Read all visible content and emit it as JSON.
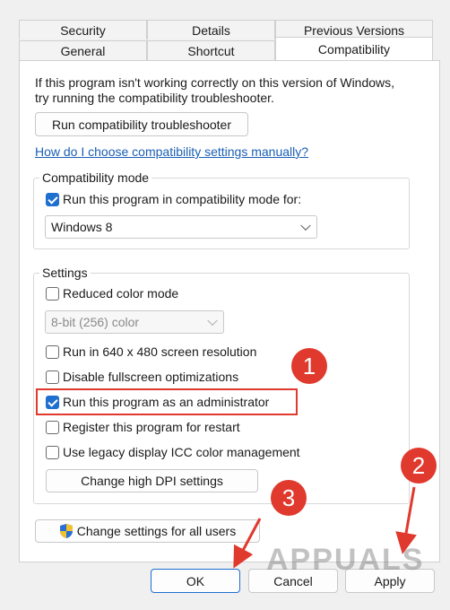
{
  "tabs_row1": [
    "Security",
    "Details",
    "Previous Versions"
  ],
  "tabs_row2": [
    "General",
    "Shortcut",
    "Compatibility"
  ],
  "intro_text": "If this program isn't working correctly on this version of Windows, try running the compatibility troubleshooter.",
  "troubleshooter_button": "Run compatibility troubleshooter",
  "help_link": "How do I choose compatibility settings manually?",
  "compat_mode": {
    "label": "Compatibility mode",
    "checkbox_label": "Run this program in compatibility mode for:",
    "checked": true,
    "selected": "Windows 8"
  },
  "settings": {
    "label": "Settings",
    "reduced_color": {
      "label": "Reduced color mode",
      "checked": false
    },
    "color_select": "8-bit (256) color",
    "items": [
      {
        "label": "Run in 640 x 480 screen resolution",
        "checked": false
      },
      {
        "label": "Disable fullscreen optimizations",
        "checked": false
      },
      {
        "label": "Run this program as an administrator",
        "checked": true
      },
      {
        "label": "Register this program for restart",
        "checked": false
      },
      {
        "label": "Use legacy display ICC color management",
        "checked": false
      }
    ],
    "dpi_button": "Change high DPI settings"
  },
  "all_users_button": "Change settings for all users",
  "footer": {
    "ok": "OK",
    "cancel": "Cancel",
    "apply": "Apply"
  },
  "annotations": [
    "1",
    "2",
    "3"
  ],
  "watermark": "APPUALS",
  "colors": {
    "accent": "#1f6fcf",
    "annotation": "#e0392e",
    "link": "#1a5fb4"
  }
}
